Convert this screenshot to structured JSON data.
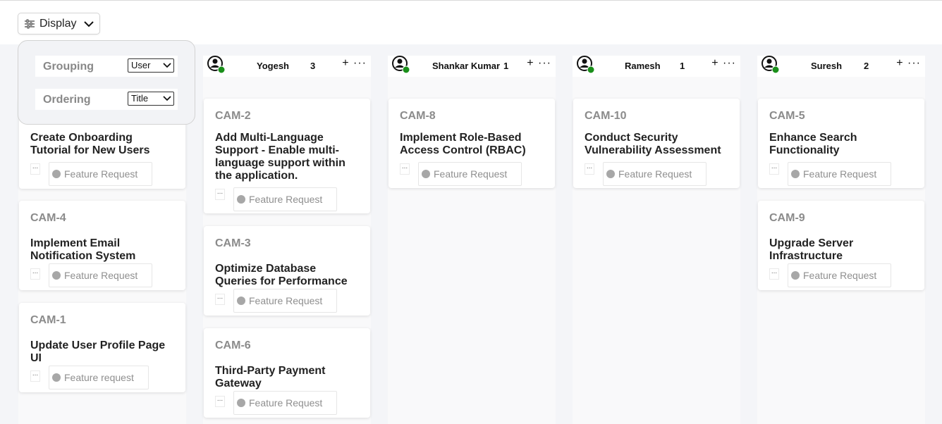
{
  "toolbar": {
    "display_label": "Display"
  },
  "display_menu": {
    "grouping_label": "Grouping",
    "grouping_value": "User",
    "ordering_label": "Ordering",
    "ordering_value": "Title"
  },
  "columns": [
    {
      "name": "",
      "count": "",
      "cards": [
        {
          "id": "",
          "title": "Create Onboarding Tutorial for New Users",
          "tag": "Feature Request"
        },
        {
          "id": "CAM-4",
          "title": "Implement Email Notification System",
          "tag": "Feature Request"
        },
        {
          "id": "CAM-1",
          "title": "Update User Profile Page UI",
          "tag": "Feature request"
        }
      ]
    },
    {
      "name": "Yogesh",
      "count": "3",
      "add_icon": "+",
      "more_icon": "···",
      "cards": [
        {
          "id": "CAM-2",
          "title": "Add Multi-Language Support - Enable multi-language support within the application.",
          "tag": "Feature Request"
        },
        {
          "id": "CAM-3",
          "title": "Optimize Database Queries for Performance",
          "tag": "Feature Request"
        },
        {
          "id": "CAM-6",
          "title": "Third-Party Payment Gateway",
          "tag": "Feature Request"
        }
      ]
    },
    {
      "name": "Shankar Kumar",
      "count": "1",
      "add_icon": "+",
      "more_icon": "···",
      "cards": [
        {
          "id": "CAM-8",
          "title": "Implement Role-Based Access Control (RBAC)",
          "tag": "Feature Request"
        }
      ]
    },
    {
      "name": "Ramesh",
      "count": "1",
      "add_icon": "+",
      "more_icon": "···",
      "cards": [
        {
          "id": "CAM-10",
          "title": "Conduct Security Vulnerability Assessment",
          "tag": "Feature Request"
        }
      ]
    },
    {
      "name": "Suresh",
      "count": "2",
      "add_icon": "+",
      "more_icon": "···",
      "cards": [
        {
          "id": "CAM-5",
          "title": "Enhance Search Functionality",
          "tag": "Feature Request"
        },
        {
          "id": "CAM-9",
          "title": "Upgrade Server Infrastructure",
          "tag": "Feature Request"
        }
      ]
    }
  ],
  "card_more_icon": "...",
  "colors": {
    "online": "#1a8f1a",
    "tag_dot": "#a7a7a7",
    "id_text": "#8b8b8b"
  }
}
